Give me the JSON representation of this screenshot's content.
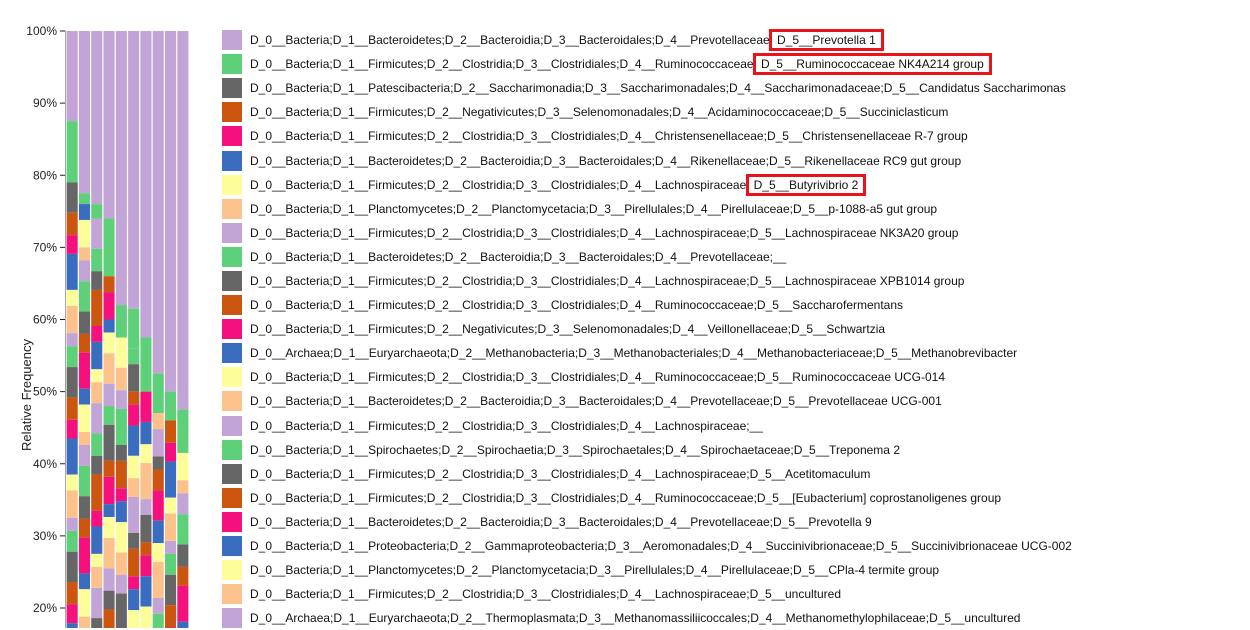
{
  "chart_data": {
    "type": "stacked-bar",
    "ylabel": "Relative Frequency",
    "ylim": [
      17,
      100
    ],
    "yticks": [
      "20%",
      "30%",
      "40%",
      "50%",
      "60%",
      "70%",
      "80%",
      "90%",
      "100%"
    ],
    "sample_count": 10,
    "series": [
      {
        "name": "D_0__Bacteria;D_1__Bacteroidetes;D_2__Bacteroidia;D_3__Bacteroidales;D_4__Prevotellaceae;D_5__Prevotella 1",
        "color": "#c2a5d6",
        "highlight": "D_5__Prevotella 1",
        "top": [
          100,
          100,
          100,
          100,
          100,
          100,
          100,
          100,
          100,
          100
        ],
        "bottom": [
          87.5,
          77.5,
          76,
          74,
          62,
          61.5,
          57.5,
          52.5,
          50,
          47.5
        ]
      },
      {
        "name": "D_0__Bacteria;D_1__Firmicutes;D_2__Clostridia;D_3__Clostridiales;D_4__Ruminococcaceae;D_5__Ruminococcaceae NK4A214 group",
        "color": "#5fd07a",
        "highlight": "D_5__Ruminococcaceae NK4A214 group",
        "top": [
          87.5,
          77.5,
          76,
          74,
          62,
          61.5,
          57.5,
          52.5,
          50,
          47.5
        ],
        "bottom": [
          79,
          76,
          74,
          66,
          57.5,
          56,
          50,
          47,
          46,
          41.5
        ]
      },
      {
        "name": "D_0__Bacteria;D_1__Patescibacteria;D_2__Saccharimonadia;D_3__Saccharimonadales;D_4__Saccharimonadaceae;D_5__Candidatus Saccharimonas"
      },
      {
        "name": "D_0__Bacteria;D_1__Firmicutes;D_2__Negativicutes;D_3__Selenomonadales;D_4__Acidaminococcaceae;D_5__Succiniclasticum"
      },
      {
        "name": "D_0__Bacteria;D_1__Firmicutes;D_2__Clostridia;D_3__Clostridiales;D_4__Christensenellaceae;D_5__Christensenellaceae R-7 group"
      },
      {
        "name": "D_0__Bacteria;D_1__Bacteroidetes;D_2__Bacteroidia;D_3__Bacteroidales;D_4__Rikenellaceae;D_5__Rikenellaceae RC9 gut group"
      },
      {
        "name": "D_0__Bacteria;D_1__Firmicutes;D_2__Clostridia;D_3__Clostridiales;D_4__Lachnospiraceae;D_5__Butyrivibrio 2",
        "highlight": "D_5__Butyrivibrio 2"
      },
      {
        "name": "D_0__Bacteria;D_1__Planctomycetes;D_2__Planctomycetacia;D_3__Pirellulales;D_4__Pirellulaceae;D_5__p-1088-a5 gut group"
      },
      {
        "name": "D_0__Bacteria;D_1__Firmicutes;D_2__Clostridia;D_3__Clostridiales;D_4__Lachnospiraceae;D_5__Lachnospiraceae NK3A20 group"
      },
      {
        "name": "D_0__Bacteria;D_1__Bacteroidetes;D_2__Bacteroidia;D_3__Bacteroidales;D_4__Prevotellaceae;__"
      },
      {
        "name": "D_0__Bacteria;D_1__Firmicutes;D_2__Clostridia;D_3__Clostridiales;D_4__Lachnospiraceae;D_5__Lachnospiraceae XPB1014 group"
      },
      {
        "name": "D_0__Bacteria;D_1__Firmicutes;D_2__Clostridia;D_3__Clostridiales;D_4__Ruminococcaceae;D_5__Saccharofermentans"
      },
      {
        "name": "D_0__Bacteria;D_1__Firmicutes;D_2__Negativicutes;D_3__Selenomonadales;D_4__Veillonellaceae;D_5__Schwartzia"
      },
      {
        "name": "D_0__Archaea;D_1__Euryarchaeota;D_2__Methanobacteria;D_3__Methanobacteriales;D_4__Methanobacteriaceae;D_5__Methanobrevibacter"
      },
      {
        "name": "D_0__Bacteria;D_1__Firmicutes;D_2__Clostridia;D_3__Clostridiales;D_4__Ruminococcaceae;D_5__Ruminococcaceae UCG-014"
      },
      {
        "name": "D_0__Bacteria;D_1__Bacteroidetes;D_2__Bacteroidia;D_3__Bacteroidales;D_4__Prevotellaceae;D_5__Prevotellaceae UCG-001"
      },
      {
        "name": "D_0__Bacteria;D_1__Firmicutes;D_2__Clostridia;D_3__Clostridiales;D_4__Lachnospiraceae;__"
      },
      {
        "name": "D_0__Bacteria;D_1__Spirochaetes;D_2__Spirochaetia;D_3__Spirochaetales;D_4__Spirochaetaceae;D_5__Treponema 2"
      },
      {
        "name": "D_0__Bacteria;D_1__Firmicutes;D_2__Clostridia;D_3__Clostridiales;D_4__Lachnospiraceae;D_5__Acetitomaculum"
      },
      {
        "name": "D_0__Bacteria;D_1__Firmicutes;D_2__Clostridia;D_3__Clostridiales;D_4__Ruminococcaceae;D_5__[Eubacterium] coprostanoligenes group"
      },
      {
        "name": "D_0__Bacteria;D_1__Bacteroidetes;D_2__Bacteroidia;D_3__Bacteroidales;D_4__Prevotellaceae;D_5__Prevotella 9"
      },
      {
        "name": "D_0__Bacteria;D_1__Proteobacteria;D_2__Gammaproteobacteria;D_3__Aeromonadales;D_4__Succinivibrionaceae;D_5__Succinivibrionaceae UCG-002"
      },
      {
        "name": "D_0__Bacteria;D_1__Planctomycetes;D_2__Planctomycetacia;D_3__Pirellulales;D_4__Pirellulaceae;D_5__CPla-4 termite group"
      },
      {
        "name": "D_0__Bacteria;D_1__Firmicutes;D_2__Clostridia;D_3__Clostridiales;D_4__Lachnospiraceae;D_5__uncultured"
      },
      {
        "name": "D_0__Archaea;D_1__Euryarchaeota;D_2__Thermoplasmata;D_3__Methanomassiliicoccales;D_4__Methanomethylophilaceae;D_5__uncultured"
      }
    ],
    "palette": [
      "#c2a5d6",
      "#5fd07a",
      "#666666",
      "#cc5510",
      "#f5117d",
      "#3a6cbf",
      "#fdfd99",
      "#fdc28b"
    ]
  }
}
